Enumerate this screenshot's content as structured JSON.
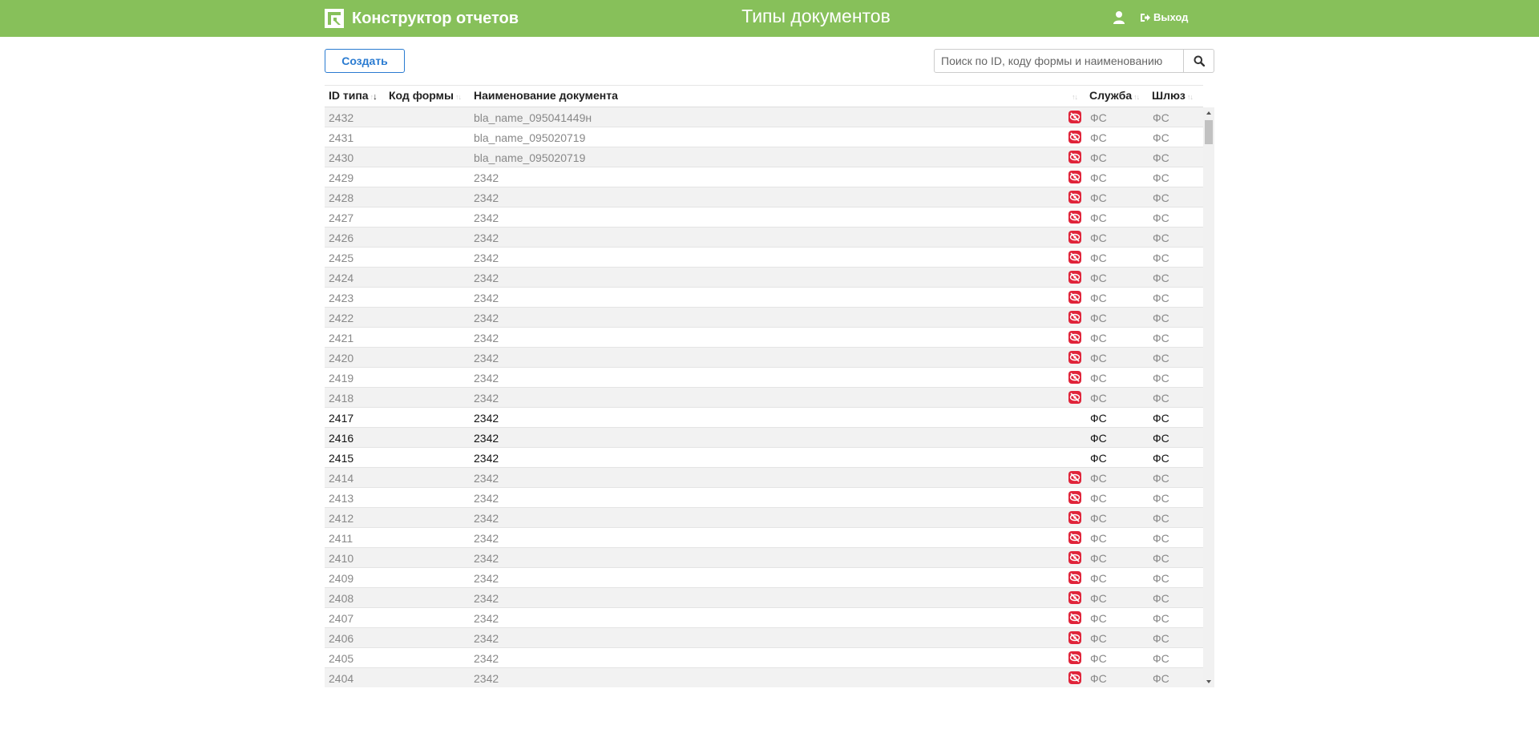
{
  "header": {
    "brand": "Конструктор отчетов",
    "title": "Типы документов",
    "logout_label": "Выход",
    "bg_color": "#87c05a"
  },
  "toolbar": {
    "create_label": "Создать",
    "search_placeholder": "Поиск по ID, коду формы и наименованию"
  },
  "table": {
    "columns": {
      "id": "ID типа",
      "form_code": "Код формы",
      "name": "Наименование документа",
      "service": "Служба",
      "gateway": "Шлюз"
    },
    "sort": {
      "column": "id",
      "direction": "desc"
    },
    "rows": [
      {
        "id": "2432",
        "form_code": "",
        "name": "bla_name_095041449н",
        "hidden": true,
        "service": "ФС",
        "gateway": "ФС"
      },
      {
        "id": "2431",
        "form_code": "",
        "name": "bla_name_095020719",
        "hidden": true,
        "service": "ФС",
        "gateway": "ФС"
      },
      {
        "id": "2430",
        "form_code": "",
        "name": "bla_name_095020719",
        "hidden": true,
        "service": "ФС",
        "gateway": "ФС"
      },
      {
        "id": "2429",
        "form_code": "",
        "name": "2342",
        "hidden": true,
        "service": "ФС",
        "gateway": "ФС"
      },
      {
        "id": "2428",
        "form_code": "",
        "name": "2342",
        "hidden": true,
        "service": "ФС",
        "gateway": "ФС"
      },
      {
        "id": "2427",
        "form_code": "",
        "name": "2342",
        "hidden": true,
        "service": "ФС",
        "gateway": "ФС"
      },
      {
        "id": "2426",
        "form_code": "",
        "name": "2342",
        "hidden": true,
        "service": "ФС",
        "gateway": "ФС"
      },
      {
        "id": "2425",
        "form_code": "",
        "name": "2342",
        "hidden": true,
        "service": "ФС",
        "gateway": "ФС"
      },
      {
        "id": "2424",
        "form_code": "",
        "name": "2342",
        "hidden": true,
        "service": "ФС",
        "gateway": "ФС"
      },
      {
        "id": "2423",
        "form_code": "",
        "name": "2342",
        "hidden": true,
        "service": "ФС",
        "gateway": "ФС"
      },
      {
        "id": "2422",
        "form_code": "",
        "name": "2342",
        "hidden": true,
        "service": "ФС",
        "gateway": "ФС"
      },
      {
        "id": "2421",
        "form_code": "",
        "name": "2342",
        "hidden": true,
        "service": "ФС",
        "gateway": "ФС"
      },
      {
        "id": "2420",
        "form_code": "",
        "name": "2342",
        "hidden": true,
        "service": "ФС",
        "gateway": "ФС"
      },
      {
        "id": "2419",
        "form_code": "",
        "name": "2342",
        "hidden": true,
        "service": "ФС",
        "gateway": "ФС"
      },
      {
        "id": "2418",
        "form_code": "",
        "name": "2342",
        "hidden": true,
        "service": "ФС",
        "gateway": "ФС"
      },
      {
        "id": "2417",
        "form_code": "",
        "name": "2342",
        "hidden": false,
        "service": "ФС",
        "gateway": "ФС"
      },
      {
        "id": "2416",
        "form_code": "",
        "name": "2342",
        "hidden": false,
        "service": "ФС",
        "gateway": "ФС"
      },
      {
        "id": "2415",
        "form_code": "",
        "name": "2342",
        "hidden": false,
        "service": "ФС",
        "gateway": "ФС"
      },
      {
        "id": "2414",
        "form_code": "",
        "name": "2342",
        "hidden": true,
        "service": "ФС",
        "gateway": "ФС"
      },
      {
        "id": "2413",
        "form_code": "",
        "name": "2342",
        "hidden": true,
        "service": "ФС",
        "gateway": "ФС"
      },
      {
        "id": "2412",
        "form_code": "",
        "name": "2342",
        "hidden": true,
        "service": "ФС",
        "gateway": "ФС"
      },
      {
        "id": "2411",
        "form_code": "",
        "name": "2342",
        "hidden": true,
        "service": "ФС",
        "gateway": "ФС"
      },
      {
        "id": "2410",
        "form_code": "",
        "name": "2342",
        "hidden": true,
        "service": "ФС",
        "gateway": "ФС"
      },
      {
        "id": "2409",
        "form_code": "",
        "name": "2342",
        "hidden": true,
        "service": "ФС",
        "gateway": "ФС"
      },
      {
        "id": "2408",
        "form_code": "",
        "name": "2342",
        "hidden": true,
        "service": "ФС",
        "gateway": "ФС"
      },
      {
        "id": "2407",
        "form_code": "",
        "name": "2342",
        "hidden": true,
        "service": "ФС",
        "gateway": "ФС"
      },
      {
        "id": "2406",
        "form_code": "",
        "name": "2342",
        "hidden": true,
        "service": "ФС",
        "gateway": "ФС"
      },
      {
        "id": "2405",
        "form_code": "",
        "name": "2342",
        "hidden": true,
        "service": "ФС",
        "gateway": "ФС"
      },
      {
        "id": "2404",
        "form_code": "",
        "name": "2342",
        "hidden": true,
        "service": "ФС",
        "gateway": "ФС"
      }
    ],
    "hidden_icon": "eye-slash-icon",
    "hidden_icon_color": "#e0243a"
  }
}
